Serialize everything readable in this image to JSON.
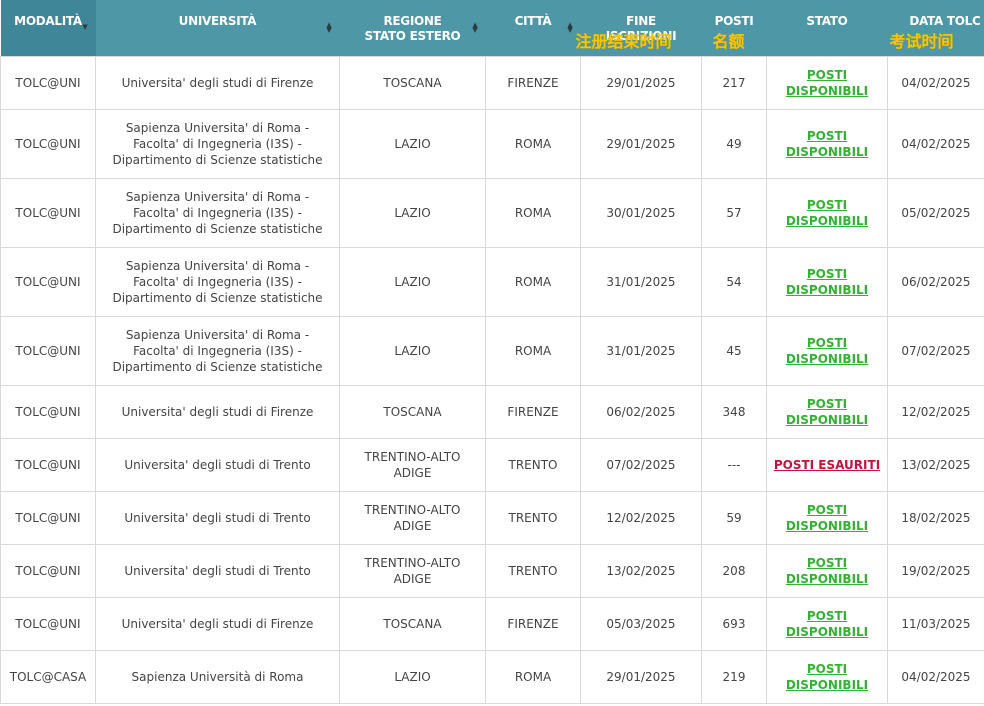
{
  "header": {
    "modalita": "MODALITÀ",
    "universita": "UNIVERSITÀ",
    "regione_l1": "REGIONE",
    "regione_l2": "STATO ESTERO",
    "citta": "CITTÀ",
    "fine_l1": "FINE",
    "fine_l2": "ISCRIZIONI",
    "posti": "POSTI",
    "stato": "STATO",
    "data": "DATA TOLC",
    "hint_fine": "注册结束时间",
    "hint_posti": "名额",
    "hint_data": "考试时间"
  },
  "rows": [
    {
      "modalita": "TOLC@UNI",
      "universita": "Universita' degli studi di Firenze",
      "regione": "TOSCANA",
      "citta": "FIRENZE",
      "fine": "29/01/2025",
      "posti": "217",
      "stato": "POSTI DISPONIBILI",
      "data": "04/02/2025"
    },
    {
      "modalita": "TOLC@UNI",
      "universita": "Sapienza Universita' di Roma - Facolta' di Ingegneria (I3S) - Dipartimento di Scienze statistiche",
      "regione": "LAZIO",
      "citta": "ROMA",
      "fine": "29/01/2025",
      "posti": "49",
      "stato": "POSTI DISPONIBILI",
      "data": "04/02/2025"
    },
    {
      "modalita": "TOLC@UNI",
      "universita": "Sapienza Universita' di Roma - Facolta' di Ingegneria (I3S) - Dipartimento di Scienze statistiche",
      "regione": "LAZIO",
      "citta": "ROMA",
      "fine": "30/01/2025",
      "posti": "57",
      "stato": "POSTI DISPONIBILI",
      "data": "05/02/2025"
    },
    {
      "modalita": "TOLC@UNI",
      "universita": "Sapienza Universita' di Roma - Facolta' di Ingegneria (I3S) - Dipartimento di Scienze statistiche",
      "regione": "LAZIO",
      "citta": "ROMA",
      "fine": "31/01/2025",
      "posti": "54",
      "stato": "POSTI DISPONIBILI",
      "data": "06/02/2025"
    },
    {
      "modalita": "TOLC@UNI",
      "universita": "Sapienza Universita' di Roma - Facolta' di Ingegneria (I3S) - Dipartimento di Scienze statistiche",
      "regione": "LAZIO",
      "citta": "ROMA",
      "fine": "31/01/2025",
      "posti": "45",
      "stato": "POSTI DISPONIBILI",
      "data": "07/02/2025"
    },
    {
      "modalita": "TOLC@UNI",
      "universita": "Universita' degli studi di Firenze",
      "regione": "TOSCANA",
      "citta": "FIRENZE",
      "fine": "06/02/2025",
      "posti": "348",
      "stato": "POSTI DISPONIBILI",
      "data": "12/02/2025"
    },
    {
      "modalita": "TOLC@UNI",
      "universita": "Universita' degli studi di Trento",
      "regione": "TRENTINO-ALTO ADIGE",
      "citta": "TRENTO",
      "fine": "07/02/2025",
      "posti": "---",
      "stato": "POSTI ESAURITI",
      "data": "13/02/2025"
    },
    {
      "modalita": "TOLC@UNI",
      "universita": "Universita' degli studi di Trento",
      "regione": "TRENTINO-ALTO ADIGE",
      "citta": "TRENTO",
      "fine": "12/02/2025",
      "posti": "59",
      "stato": "POSTI DISPONIBILI",
      "data": "18/02/2025"
    },
    {
      "modalita": "TOLC@UNI",
      "universita": "Universita' degli studi di Trento",
      "regione": "TRENTINO-ALTO ADIGE",
      "citta": "TRENTO",
      "fine": "13/02/2025",
      "posti": "208",
      "stato": "POSTI DISPONIBILI",
      "data": "19/02/2025"
    },
    {
      "modalita": "TOLC@UNI",
      "universita": "Universita' degli studi di Firenze",
      "regione": "TOSCANA",
      "citta": "FIRENZE",
      "fine": "05/03/2025",
      "posti": "693",
      "stato": "POSTI DISPONIBILI",
      "data": "11/03/2025"
    },
    {
      "modalita": "TOLC@CASA",
      "universita": "Sapienza Università di Roma",
      "regione": "LAZIO",
      "citta": "ROMA",
      "fine": "29/01/2025",
      "posti": "219",
      "stato": "POSTI DISPONIBILI",
      "data": "04/02/2025"
    }
  ],
  "colors": {
    "header_bg": "#4e97a7",
    "header_sorted_bg": "#3f8798",
    "available": "#33b233",
    "sold_out": "#c4123a",
    "hint": "#f7c600"
  },
  "icons": {
    "sort": "sort-arrows-icon",
    "sort_active": "sort-desc-icon"
  }
}
